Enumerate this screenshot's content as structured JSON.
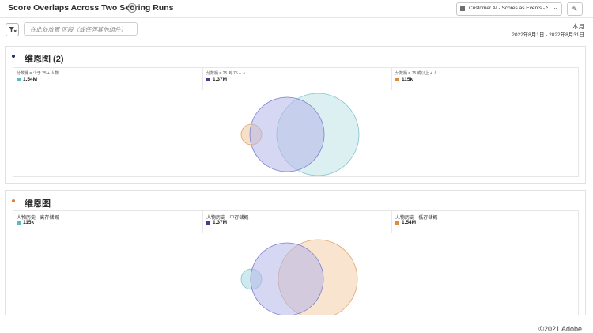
{
  "header": {
    "title": "Score Overlaps Across Two Scoring Runs",
    "info_icon": "?",
    "suite_icon": "report-suite-icon",
    "suite_label": "Customer AI - Scores as Events - Sh...",
    "edit_icon": "pencil-icon"
  },
  "filter_bar": {
    "filter_icon": "filter-icon",
    "placeholder": "在此处放置 区段（或任何其他组件）",
    "date_label": "本月",
    "date_range": "2022年8月1日 - 2022年8月31日"
  },
  "panels": [
    {
      "title": "维恩图 (2)",
      "dot_color": "#1f2b6b",
      "legend": [
        {
          "label": "分数桶 = 少于 25 + 人数",
          "value": "1.54M",
          "color": "#5fb7c8"
        },
        {
          "label": "分数桶 = 25 到 75 + 人",
          "value": "1.37M",
          "color": "#3b3fa0"
        },
        {
          "label": "分数桶 = 75 或以上 + 人",
          "value": "115k",
          "color": "#e08a3c"
        }
      ]
    },
    {
      "title": "维恩图",
      "dot_color": "#e07b39",
      "legend": [
        {
          "label": "人物历史 - 高存储概",
          "value": "115k",
          "color": "#5fb7c8"
        },
        {
          "label": "人物历史 - 中存储概",
          "value": "1.37M",
          "color": "#3b3fa0"
        },
        {
          "label": "人物历史 - 低存储概",
          "value": "1.54M",
          "color": "#e08a3c"
        }
      ]
    }
  ],
  "footer": {
    "copyright": "©2021 Adobe"
  }
}
